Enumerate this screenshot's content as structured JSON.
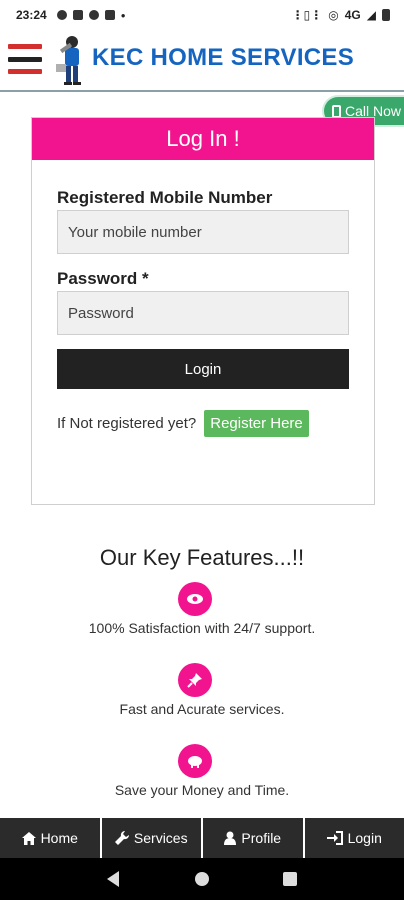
{
  "status_bar": {
    "time": "23:24",
    "network": "4G"
  },
  "header": {
    "brand": "KEC HOME SERVICES"
  },
  "call_now": {
    "label": "Call Now"
  },
  "login_card": {
    "title": "Log In !",
    "mobile_label": "Registered Mobile Number",
    "mobile_placeholder": "Your mobile number",
    "password_label": "Password *",
    "password_placeholder": "Password",
    "login_button": "Login",
    "register_prompt": "If Not registered yet?",
    "register_button": "Register Here"
  },
  "features": {
    "title": "Our Key Features...!!",
    "items": [
      {
        "text": "100% Satisfaction with 24/7 support.",
        "icon": "eye-icon"
      },
      {
        "text": "Fast and Acurate services.",
        "icon": "pin-icon"
      },
      {
        "text": "Save your Money and Time.",
        "icon": "piggy-bank-icon"
      }
    ]
  },
  "bottom_nav": {
    "items": [
      {
        "label": "Home",
        "icon": "home-icon"
      },
      {
        "label": "Services",
        "icon": "wrench-icon"
      },
      {
        "label": "Profile",
        "icon": "user-icon"
      },
      {
        "label": "Login",
        "icon": "login-icon"
      }
    ]
  },
  "colors": {
    "accent": "#f2148f",
    "brand": "#1565c0",
    "call_green": "#3aa86a",
    "register_green": "#5cb85c"
  }
}
